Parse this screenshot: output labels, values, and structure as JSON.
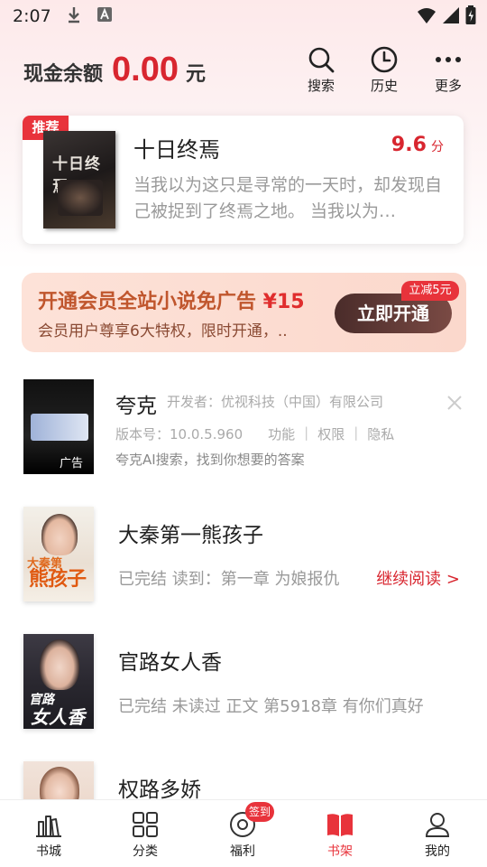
{
  "status_bar": {
    "time": "2:07"
  },
  "header": {
    "balance_label": "现金余额",
    "balance_amount": "0.00",
    "balance_unit": "元",
    "buttons": [
      {
        "label": "搜索",
        "icon": "search-icon"
      },
      {
        "label": "历史",
        "icon": "clock-icon"
      },
      {
        "label": "更多",
        "icon": "more-icon"
      }
    ]
  },
  "recommend": {
    "badge": "推荐",
    "cover_text": "十日终焉",
    "title": "十日终焉",
    "score": "9.6",
    "score_unit": "分",
    "desc": "当我以为这只是寻常的一天时，却发现自己被捉到了终焉之地。 当我以为…"
  },
  "vip": {
    "title": "开通会员全站小说免广告 ",
    "price": "¥15",
    "subtitle": "会员用户尊享6大特权，限时开通，..",
    "button": "立即开通",
    "tag": "立减5元"
  },
  "ad": {
    "label": "广告",
    "name": "夸克",
    "developer": "开发者：优视科技（中国）有限公司",
    "version": "版本号：10.0.5.960",
    "links": [
      "功能",
      "权限",
      "隐私"
    ],
    "desc": "夸克AI搜索，找到你想要的答案"
  },
  "books": [
    {
      "title": "大秦第一熊孩子",
      "info": "已完结 读到：第一章 为娘报仇",
      "continue": "继续阅读 >",
      "cover_line1": "大秦第",
      "cover_line2": "熊孩子"
    },
    {
      "title": "官路女人香",
      "info": "已完结 未读过 正文 第5918章 有你们真好",
      "cover_line1": "官路",
      "cover_line2": "女人香"
    },
    {
      "title": "权路多娇",
      "info": ""
    }
  ],
  "bottom_nav": [
    {
      "label": "书城",
      "icon": "bookstore-icon"
    },
    {
      "label": "分类",
      "icon": "grid-icon"
    },
    {
      "label": "福利",
      "icon": "welfare-icon",
      "badge": "签到"
    },
    {
      "label": "书架",
      "icon": "bookshelf-icon",
      "active": true
    },
    {
      "label": "我的",
      "icon": "profile-icon"
    }
  ],
  "colors": {
    "accent": "#e8333b",
    "price": "#d8262f"
  }
}
